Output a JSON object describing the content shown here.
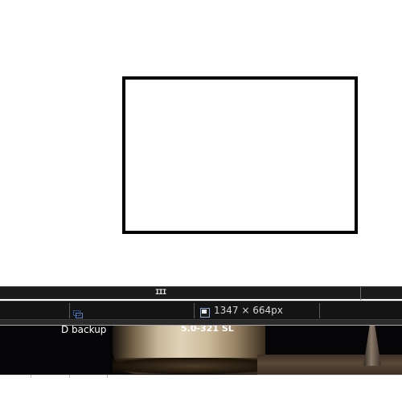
{
  "canvas": {
    "background": "#ffffff",
    "selection_border_color": "#000000"
  },
  "handle_bar": {
    "grip_glyph": "III"
  },
  "status_bar": {
    "selection_icon": "selection-icon",
    "dimension_icon": "dimension-icon",
    "dimensions": "1347 × 664px",
    "accent": "#3b7be0"
  },
  "background_items": [
    {
      "label": "D backup"
    },
    {
      "label": "5.0-321 SL"
    }
  ]
}
